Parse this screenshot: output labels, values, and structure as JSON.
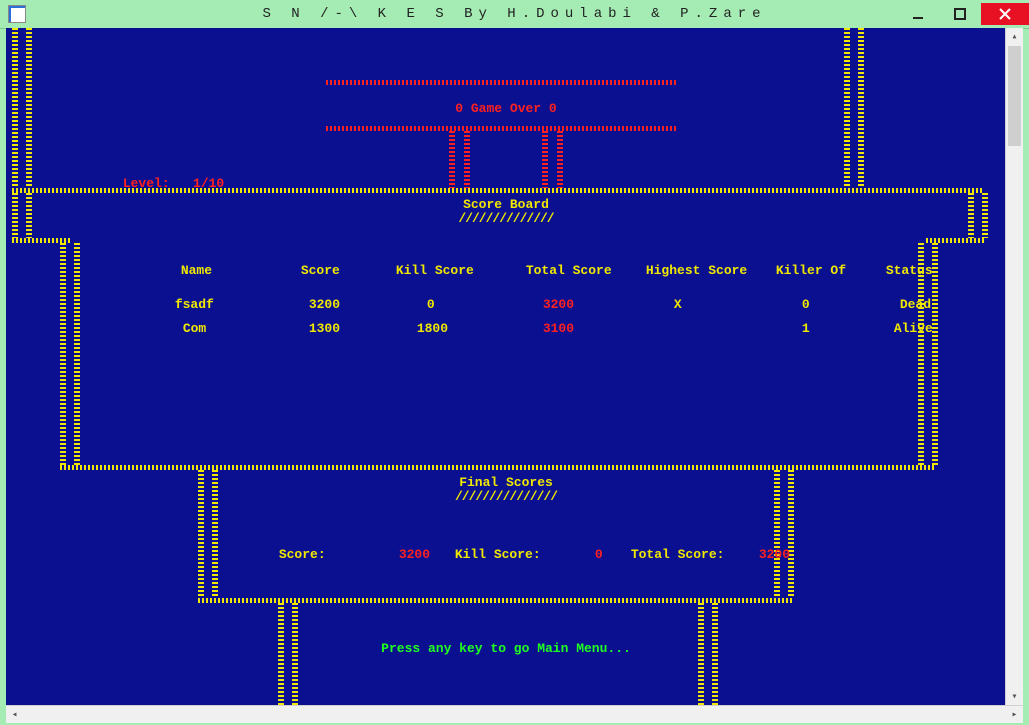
{
  "window": {
    "title": "S N /-\\ K E S  By H.Doulabi & P.Zare"
  },
  "game_over_text": "0 Game Over 0",
  "level_label": "Level:",
  "level_value": "1/10",
  "scoreboard": {
    "title": "Score Board",
    "underline": "//////////////",
    "headers": {
      "name": "Name",
      "score": "Score",
      "kill": "Kill Score",
      "total": "Total Score",
      "highest": "Highest Score",
      "killer": "Killer Of",
      "status": "Status"
    },
    "rows": [
      {
        "name": "fsadf",
        "score": "3200",
        "kill": "0",
        "total": "3200",
        "highest": "X",
        "killer": "0",
        "status": "Dead"
      },
      {
        "name": "Com",
        "score": "1300",
        "kill": "1800",
        "total": "3100",
        "highest": "",
        "killer": "1",
        "status": "Alive"
      }
    ]
  },
  "final": {
    "title": "Final Scores",
    "underline": "///////////////",
    "score_label": "Score:",
    "score_value": "3200",
    "kill_label": "Kill Score:",
    "kill_value": "0",
    "total_label": "Total Score:",
    "total_value": "3200"
  },
  "prompt": "Press any key to go Main Menu..."
}
